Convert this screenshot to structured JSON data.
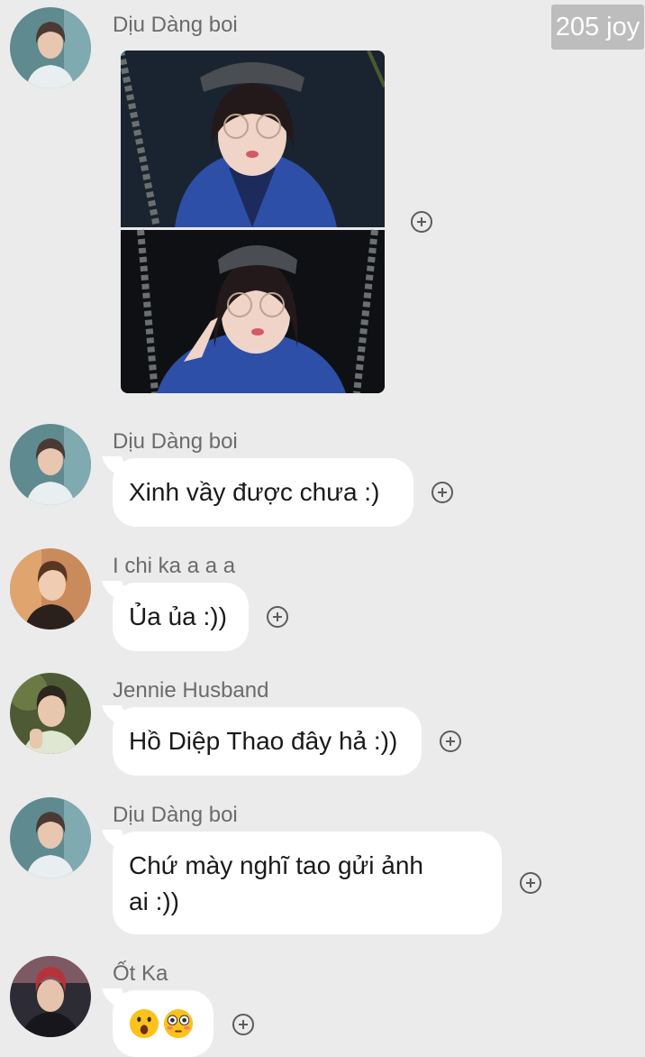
{
  "watermark": "205 joy",
  "messages": [
    {
      "sender": "Dịu Dàng boi",
      "type": "image"
    },
    {
      "sender": "Dịu Dàng boi",
      "text": "Xinh vầy được chưa :)"
    },
    {
      "sender": "I chi ka a a a",
      "text": "Ủa ủa :))"
    },
    {
      "sender": "Jennie Husband",
      "text": "Hồ Diệp Thao đây hả :))"
    },
    {
      "sender": "Dịu Dàng boi",
      "text_line1": "Chứ mày nghĩ tao gửi ảnh",
      "text_line2": "ai :))"
    },
    {
      "sender": "Ốt Ka",
      "emojis": [
        "astonished-face",
        "flushed-face"
      ]
    }
  ],
  "colors": {
    "background": "#ebebeb",
    "bubble": "#ffffff",
    "sender_name": "#6b6b6b",
    "badge": "#bdbdbd"
  }
}
